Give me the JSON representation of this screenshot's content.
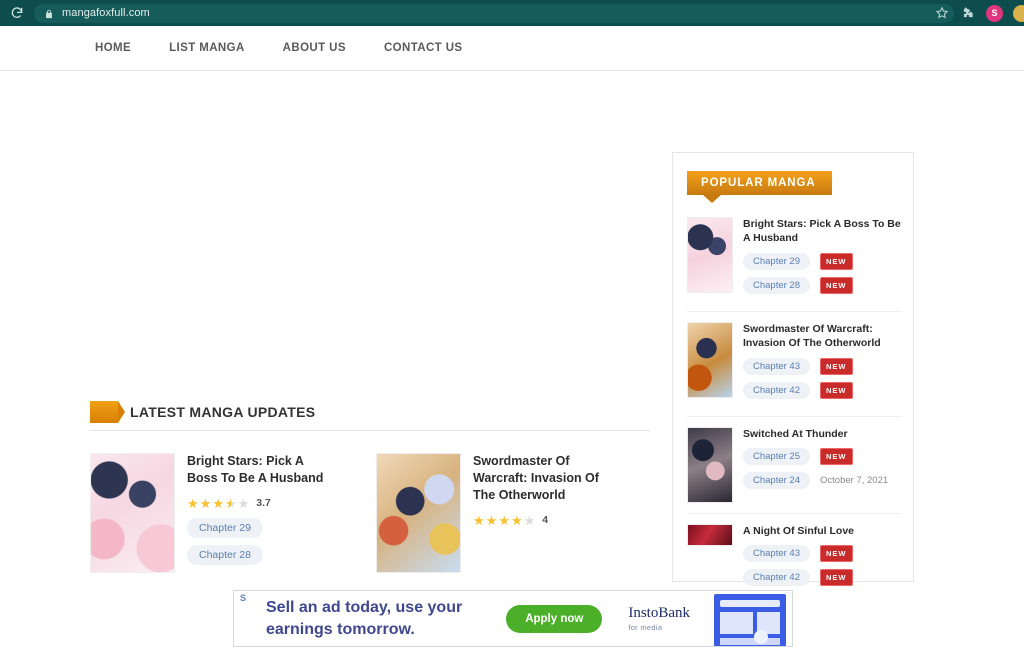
{
  "browser": {
    "reload_icon": "reload-icon",
    "lock_icon": "lock-icon",
    "url": "mangafoxfull.com",
    "bookmark_icon": "star-icon",
    "extensions_icon": "puzzle-icon",
    "avatar_initial": "S",
    "colors": {
      "toolbar": "#0e4d4d",
      "url_pill": "#155c5a",
      "avatar": "#e0357f"
    }
  },
  "site_nav": {
    "items": [
      {
        "label": "HOME"
      },
      {
        "label": "LIST MANGA"
      },
      {
        "label": "ABOUT US"
      },
      {
        "label": "CONTACT US"
      }
    ]
  },
  "main": {
    "section_title": "LATEST MANGA UPDATES",
    "cards": [
      {
        "title": "Bright Stars: Pick A Boss To Be A Husband",
        "rating": "3.7",
        "stars_full": 3,
        "stars_half": 1,
        "chips": [
          "Chapter 29",
          "Chapter 28"
        ]
      },
      {
        "title": "Swordmaster Of Warcraft: Invasion Of The Otherworld",
        "rating": "4",
        "stars_full": 4,
        "stars_half": 0,
        "chips": []
      }
    ]
  },
  "sidebar": {
    "ribbon_label": "POPULAR MANGA",
    "items": [
      {
        "title": "Bright Stars: Pick A Boss To Be A Husband",
        "rows": [
          {
            "chapter": "Chapter 29",
            "badge": "NEW",
            "date": ""
          },
          {
            "chapter": "Chapter 28",
            "badge": "NEW",
            "date": ""
          }
        ]
      },
      {
        "title": "Swordmaster Of Warcraft: Invasion Of The Otherworld",
        "rows": [
          {
            "chapter": "Chapter 43",
            "badge": "NEW",
            "date": ""
          },
          {
            "chapter": "Chapter 42",
            "badge": "NEW",
            "date": ""
          }
        ]
      },
      {
        "title": "Switched At Thunder",
        "rows": [
          {
            "chapter": "Chapter 25",
            "badge": "NEW",
            "date": ""
          },
          {
            "chapter": "Chapter 24",
            "badge": "",
            "date": "October 7, 2021"
          }
        ]
      },
      {
        "title": "A Night Of Sinful Love",
        "rows": [
          {
            "chapter": "Chapter 43",
            "badge": "NEW",
            "date": ""
          },
          {
            "chapter": "Chapter 42",
            "badge": "NEW",
            "date": ""
          }
        ]
      }
    ]
  },
  "ad": {
    "marker": "S",
    "headline": "Sell an ad today, use your earnings tomorrow.",
    "cta_label": "Apply now",
    "brand_name": "InstoBank",
    "brand_sub": "for media",
    "illustration": "browser-window-illustration",
    "colors": {
      "cta": "#4caf2a",
      "headline": "#3f4790"
    }
  }
}
